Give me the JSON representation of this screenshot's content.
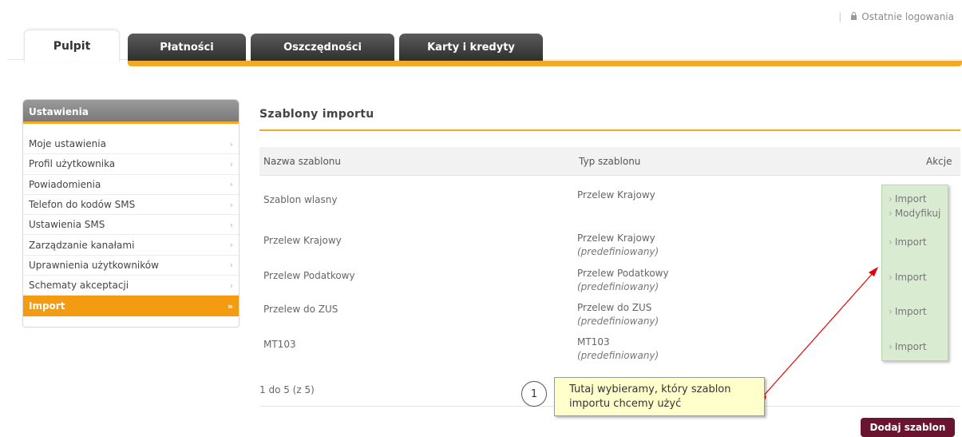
{
  "topbar": {
    "last_logins": "Ostatnie logowania"
  },
  "tabs": [
    {
      "label": "Pulpit",
      "active": true
    },
    {
      "label": "Płatności"
    },
    {
      "label": "Oszczędności"
    },
    {
      "label": "Karty i kredyty"
    }
  ],
  "sidebar": {
    "title": "Ustawienia",
    "items": [
      {
        "label": "Moje ustawienia"
      },
      {
        "label": "Profil użytkownika"
      },
      {
        "label": "Powiadomienia"
      },
      {
        "label": "Telefon do kodów SMS"
      },
      {
        "label": "Ustawienia SMS"
      },
      {
        "label": "Zarządzanie kanałami"
      },
      {
        "label": "Uprawnienia użytkowników"
      },
      {
        "label": "Schematy akceptacji"
      },
      {
        "label": "Import",
        "active": true
      }
    ]
  },
  "main": {
    "title": "Szablony importu",
    "columns": {
      "name": "Nazwa szablonu",
      "type": "Typ szablonu",
      "actions": "Akcje"
    },
    "rows": [
      {
        "name": "Szablon wlasny",
        "type": "Przelew Krajowy",
        "note": "",
        "actions": [
          "Import",
          "Modyfikuj"
        ]
      },
      {
        "name": "Przelew Krajowy",
        "type": "Przelew Krajowy",
        "note": "(predefiniowany)",
        "actions": [
          "Import"
        ]
      },
      {
        "name": "Przelew Podatkowy",
        "type": "Przelew Podatkowy",
        "note": "(predefiniowany)",
        "actions": [
          "Import"
        ]
      },
      {
        "name": "Przelew do ZUS",
        "type": "Przelew do ZUS",
        "note": "(predefiniowany)",
        "actions": [
          "Import"
        ]
      },
      {
        "name": "MT103",
        "type": "MT103",
        "note": "(predefiniowany)",
        "actions": [
          "Import"
        ]
      }
    ],
    "pager": "1 do 5 (z 5)",
    "add_button": "Dodaj szablon"
  },
  "callout": {
    "number": "1",
    "text_line1": "Tutaj wybieramy, który szablon",
    "text_line2": "importu chcemy użyć"
  },
  "colors": {
    "accent": "#f0aa28",
    "active_menu": "#f39c12",
    "button": "#6b1430",
    "actions_bg": "#d9ecd2",
    "arrow": "#e60000"
  }
}
